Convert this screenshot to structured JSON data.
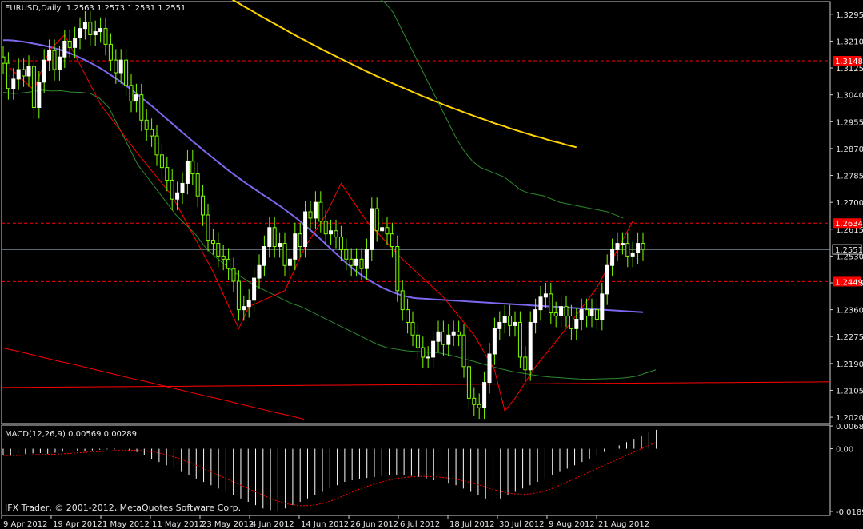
{
  "chart_data": [
    {
      "type": "candlestick",
      "title": "EURUSD,Daily",
      "ohlc_header": "1.2563 1.2573 1.2531 1.2551",
      "price_range": [
        1.2,
        1.3335
      ],
      "price_ticks": [
        "1.3295",
        "1.3210",
        "1.3125",
        "1.3040",
        "1.2955",
        "1.2870",
        "1.2785",
        "1.2700",
        "1.2615",
        "1.2530",
        "1.2445",
        "1.2360",
        "1.2275",
        "1.2190",
        "1.2105",
        "1.2020"
      ],
      "date_labels": [
        "9 Apr 2012",
        "19 Apr 2012",
        "1 May 2012",
        "11 May 2012",
        "23 May 2012",
        "4 Jun 2012",
        "14 Jun 2012",
        "26 Jun 2012",
        "6 Jul 2012",
        "18 Jul 2012",
        "30 Jul 2012",
        "9 Aug 2012",
        "21 Aug 2012"
      ],
      "current_price": "1.2551",
      "horizontal_levels": [
        {
          "label": "1.3148",
          "color": "#ff0000"
        },
        {
          "label": "1.2634",
          "color": "#ff0000"
        },
        {
          "label": "1.2449",
          "color": "#ff0000"
        }
      ],
      "closes": [
        1.314,
        1.306,
        1.309,
        1.312,
        1.31,
        1.313,
        1.3,
        1.308,
        1.315,
        1.318,
        1.312,
        1.316,
        1.321,
        1.319,
        1.322,
        1.325,
        1.327,
        1.323,
        1.324,
        1.325,
        1.32,
        1.315,
        1.311,
        1.315,
        1.307,
        1.302,
        1.304,
        1.296,
        1.293,
        1.291,
        1.285,
        1.281,
        1.277,
        1.271,
        1.273,
        1.276,
        1.283,
        1.279,
        1.272,
        1.266,
        1.258,
        1.257,
        1.253,
        1.252,
        1.249,
        1.245,
        1.236,
        1.237,
        1.239,
        1.246,
        1.25,
        1.256,
        1.262,
        1.256,
        1.257,
        1.25,
        1.252,
        1.26,
        1.256,
        1.267,
        1.265,
        1.27,
        1.264,
        1.26,
        1.261,
        1.259,
        1.255,
        1.252,
        1.25,
        1.252,
        1.249,
        1.255,
        1.268,
        1.261,
        1.262,
        1.26,
        1.256,
        1.242,
        1.236,
        1.232,
        1.228,
        1.224,
        1.221,
        1.221,
        1.226,
        1.229,
        1.225,
        1.228,
        1.229,
        1.228,
        1.218,
        1.208,
        1.206,
        1.205,
        1.213,
        1.222,
        1.23,
        1.232,
        1.234,
        1.231,
        1.232,
        1.221,
        1.217,
        1.232,
        1.236,
        1.24,
        1.241,
        1.235,
        1.234,
        1.237,
        1.234,
        1.23,
        1.233,
        1.236,
        1.234,
        1.236,
        1.233,
        1.241,
        1.25,
        1.255,
        1.257,
        1.257,
        1.253,
        1.254,
        1.257,
        1.2551
      ],
      "series": [
        {
          "name": "",
          "color": "#ffd400",
          "values": [
            1.3378,
            1.3368,
            1.3358,
            1.3349,
            1.3339,
            1.333,
            1.332,
            1.3311,
            1.3302,
            1.3292,
            1.3283,
            1.3274,
            1.3265,
            1.3256,
            1.3247,
            1.3238,
            1.3229,
            1.322,
            1.3212,
            1.3203,
            1.3195,
            1.3186,
            1.3178,
            1.317,
            1.3162,
            1.3154,
            1.3146,
            1.3138,
            1.313,
            1.3122,
            1.3114,
            1.3107,
            1.3099,
            1.3092,
            1.3084,
            1.3077,
            1.307,
            1.3063,
            1.3056,
            1.3049,
            1.3042,
            1.3035,
            1.3029,
            1.3022,
            1.3016,
            1.3009,
            1.3003,
            1.2997,
            1.2991,
            1.2985,
            1.2979,
            1.2973,
            1.2967,
            1.2962,
            1.2956,
            1.295,
            1.2945,
            1.294,
            1.2934,
            1.2929,
            1.2924,
            1.2919,
            1.2914,
            1.2909,
            1.2905,
            1.29,
            1.2895,
            1.2891,
            1.2887,
            1.2882,
            1.2878,
            1.2874
          ]
        },
        {
          "name": "",
          "color": "#7b68ee",
          "values": [
            1.3213,
            1.3213,
            1.3212,
            1.321,
            1.3208,
            1.3205,
            1.3202,
            1.3199,
            1.3196,
            1.3192,
            1.3188,
            1.3183,
            1.3178,
            1.3172,
            1.3165,
            1.3158,
            1.315,
            1.3142,
            1.3133,
            1.3124,
            1.3114,
            1.3103,
            1.3092,
            1.3081,
            1.3069,
            1.3057,
            1.3044,
            1.3031,
            1.3018,
            1.3005,
            1.2991,
            1.2977,
            1.2963,
            1.2949,
            1.2935,
            1.2921,
            1.2907,
            1.2893,
            1.288,
            1.2866,
            1.2853,
            1.284,
            1.2827,
            1.2814,
            1.2801,
            1.2789,
            1.2777,
            1.2765,
            1.2754,
            1.2743,
            1.2732,
            1.2721,
            1.2711,
            1.27,
            1.2689,
            1.2677,
            1.2665,
            1.2653,
            1.264,
            1.2626,
            1.2612,
            1.2598,
            1.2583,
            1.2568,
            1.2553,
            1.2538,
            1.2523,
            1.2508,
            1.2494,
            1.2481,
            1.2469,
            1.2458,
            1.2448,
            1.2439,
            1.243,
            1.2423,
            1.2416,
            1.241,
            1.2405,
            1.2401,
            1.2398,
            1.2396,
            1.2395,
            1.2394,
            1.2393,
            1.2392,
            1.2391,
            1.239,
            1.2389,
            1.2388,
            1.2387,
            1.2386,
            1.2385,
            1.2384,
            1.2383,
            1.2382,
            1.2381,
            1.238,
            1.2379,
            1.2378,
            1.2377,
            1.2376,
            1.2375,
            1.2374,
            1.2373,
            1.2372,
            1.2371,
            1.237,
            1.2369,
            1.2368,
            1.2367,
            1.2366,
            1.2365,
            1.2364,
            1.2363,
            1.2362,
            1.2361,
            1.236,
            1.2359,
            1.2358,
            1.2357,
            1.2356,
            1.2355,
            1.2354,
            1.2353,
            1.2352
          ]
        },
        {
          "name": "",
          "color": "#ff0000",
          "values": [
            1.2114,
            1.2115,
            1.2116,
            1.2117,
            1.2118,
            1.2119,
            1.212,
            1.2121,
            1.2122,
            1.2123,
            1.2124,
            1.2125,
            1.2126,
            1.2127,
            1.2128,
            1.2129,
            1.213,
            1.2131,
            1.2132
          ]
        },
        {
          "name": "",
          "color": "#ff0000",
          "values": [
            1.224,
            1.223,
            1.2219,
            1.2208,
            1.2197,
            1.2187,
            1.2176,
            1.2165,
            1.2154,
            1.2143,
            1.2133,
            1.2122,
            1.2111,
            1.21,
            1.2089,
            1.2079,
            1.2068,
            1.2057,
            1.2046,
            1.2035,
            1.2025,
            1.2014
          ]
        },
        {
          "name": "",
          "color": "#2e8b2e",
          "values": [
            1.3048,
            1.3044,
            1.3046,
            1.305,
            1.3055,
            1.3052,
            1.3053,
            1.3049,
            1.3048,
            1.3045,
            1.303,
            1.3,
            1.294,
            1.288,
            1.282,
            1.278,
            1.274,
            1.27,
            1.266,
            1.263,
            1.26,
            1.256,
            1.253,
            1.2505,
            1.248,
            1.246,
            1.244,
            1.2425,
            1.241,
            1.2395,
            1.238,
            1.237,
            1.2355,
            1.234,
            1.2325,
            1.231,
            1.2295,
            1.228,
            1.2265,
            1.225,
            1.224,
            1.2235,
            1.223,
            1.2228,
            1.2226,
            1.2225,
            1.222,
            1.2213,
            1.2205,
            1.2197,
            1.2188,
            1.218,
            1.2172,
            1.2165,
            1.216,
            1.2155,
            1.215,
            1.2147,
            1.2145,
            1.2143,
            1.2141,
            1.214,
            1.2141,
            1.2142,
            1.2143,
            1.2145,
            1.215,
            1.216,
            1.217
          ]
        },
        {
          "name": "",
          "color": "#2e8b2e",
          "values": [
            1.339,
            1.337,
            1.335,
            1.333,
            1.33,
            1.325,
            1.32,
            1.315,
            1.31,
            1.305,
            1.3,
            1.295,
            1.29,
            1.286,
            1.283,
            1.281,
            1.28,
            1.279,
            1.278,
            1.276,
            1.274,
            1.273,
            1.2725,
            1.272,
            1.271,
            1.27,
            1.2695,
            1.269,
            1.2685,
            1.268,
            1.2675,
            1.267,
            1.266,
            1.265
          ]
        },
        {
          "name": "",
          "color": "#ff0000",
          "values": [
            1.3145,
            1.3055,
            1.318,
            1.323,
            1.301,
            1.286,
            1.272,
            1.248,
            1.23,
            1.237,
            1.242,
            1.256,
            1.266,
            1.276,
            1.264,
            1.252,
            1.24,
            1.228,
            1.217,
            1.204,
            1.208,
            1.218,
            1.23,
            1.243,
            1.258,
            1.264
          ]
        }
      ]
    },
    {
      "type": "bar",
      "title": "MACD(12,26,9) 0.00569 0.00289",
      "y_ticks": [
        "0.00686",
        "0.00",
        "-0.0189"
      ],
      "y_range": [
        -0.0201,
        0.00712
      ],
      "values": [
        -0.002,
        -0.0022,
        -0.0019,
        -0.0016,
        -0.0014,
        -0.0013,
        -0.0015,
        -0.0012,
        -0.0009,
        -0.0007,
        -0.0006,
        -0.0006,
        -0.0005,
        -0.0003,
        -0.0002,
        -0.0002,
        -0.0003,
        -0.0006,
        -0.001,
        -0.002,
        -0.003,
        -0.004,
        -0.005,
        -0.006,
        -0.007,
        -0.008,
        -0.009,
        -0.01,
        -0.011,
        -0.012,
        -0.013,
        -0.014,
        -0.015,
        -0.016,
        -0.017,
        -0.018,
        -0.0185,
        -0.0189,
        -0.018,
        -0.017,
        -0.016,
        -0.015,
        -0.014,
        -0.013,
        -0.012,
        -0.011,
        -0.01,
        -0.0095,
        -0.009,
        -0.0088,
        -0.0085,
        -0.0082,
        -0.008,
        -0.008,
        -0.008,
        -0.0082,
        -0.0085,
        -0.009,
        -0.0095,
        -0.01,
        -0.0105,
        -0.011,
        -0.012,
        -0.013,
        -0.014,
        -0.015,
        -0.0155,
        -0.015,
        -0.014,
        -0.013,
        -0.012,
        -0.011,
        -0.01,
        -0.009,
        -0.008,
        -0.007,
        -0.006,
        -0.005,
        -0.004,
        -0.003,
        -0.002,
        -0.001,
        0.0,
        0.001,
        0.002,
        0.003,
        0.004,
        0.005,
        0.0057
      ]
    }
  ],
  "footer": {
    "copyright": "IFX Trader, © 2001-2012, MetaQuotes Software Corp."
  }
}
